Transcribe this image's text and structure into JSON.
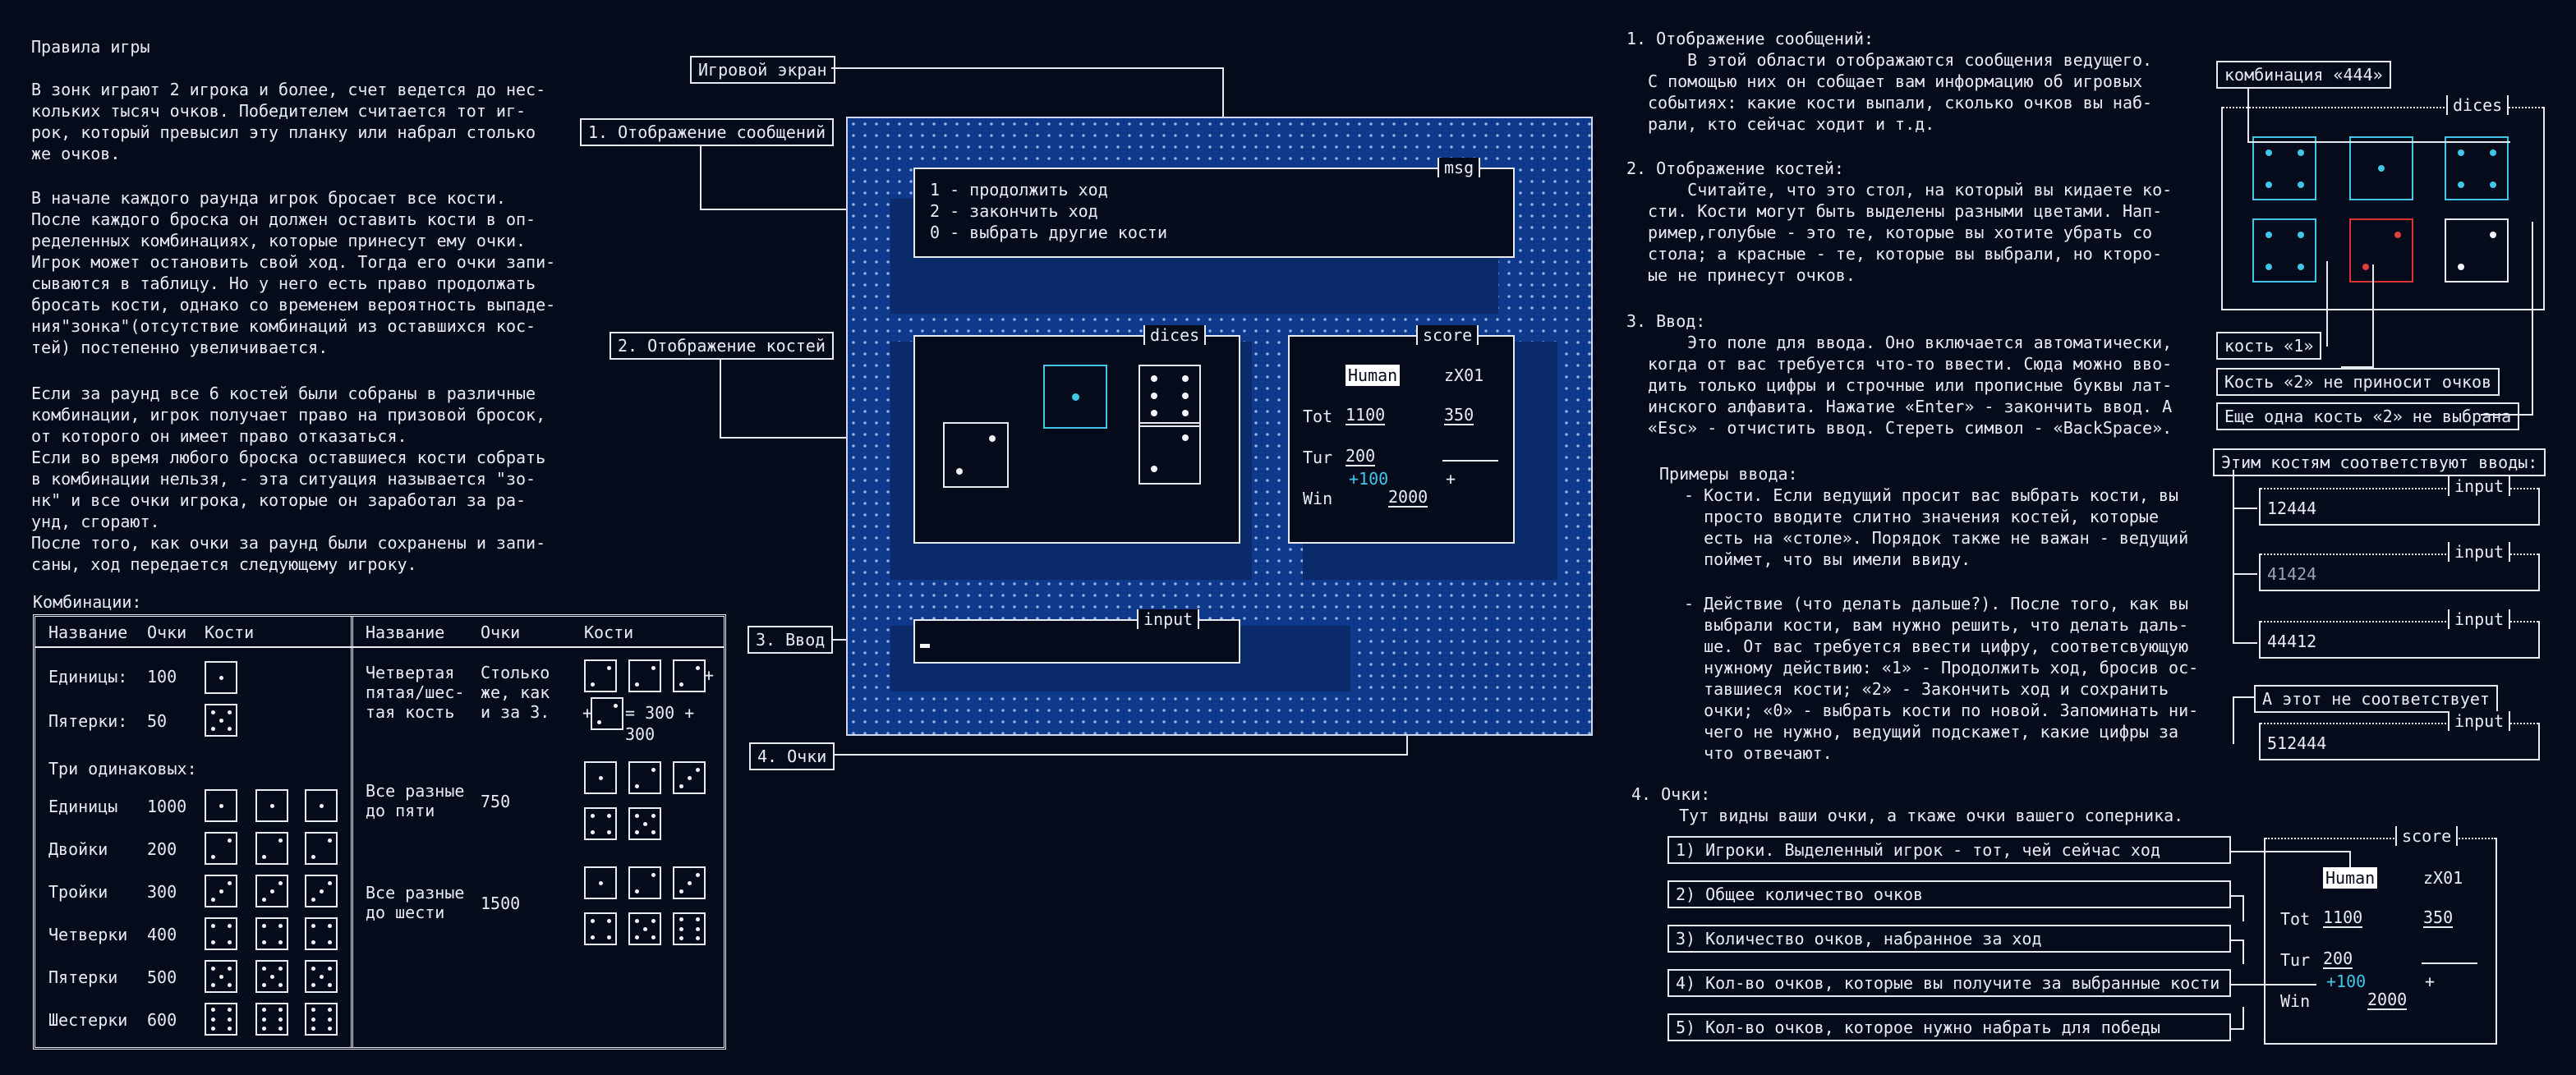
{
  "rules": {
    "title": "Правила игры",
    "p1": "В зонк играют 2 игрока и более, счет ведется до нес-\nкольких тысяч очков. Победителем считается тот иг-\nрок, который превысил эту планку или набрал столько\nже очков.",
    "p2": "В начале каждого раунда игрок бросает все кости.\nПосле каждого броска он должен оставить кости в оп-\nределенных комбинациях, которые принесут ему очки.\nИгрок может остановить свой ход. Тогда его очки запи-\nсываются в таблицу. Но у него есть право продолжать\nбросать кости, однако со временем вероятность выпаде-\nния\"зонка\"(отсутствие комбинаций из оставшихся кос-\nтей) постепенно увеличивается.",
    "p3": "Если за раунд все 6 костей были собраны в различные\nкомбинации, игрок получает право на призовой бросок,\nот которого он имеет право отказаться.\nЕсли во время любого броска оставшиеся кости собрать\nв комбинации нельзя, - эта ситуация называется \"зо-\nнк\" и все очки игрока, которые он заработал за ра-\nунд, сгорают.\nПосле того, как очки за раунд были сохранены и запи-\nсаны, ход передается следующему игроку.",
    "combos_label": "Комбинации:"
  },
  "table": {
    "headers": [
      "Название",
      "Очки",
      "Кости"
    ],
    "left_rows": [
      {
        "name": "Единицы:",
        "points": "100"
      },
      {
        "name": "Пятерки:",
        "points": "50"
      }
    ],
    "three_label": "Три одинаковых:",
    "three_rows": [
      {
        "name": "Единицы",
        "points": "1000"
      },
      {
        "name": "Двойки",
        "points": "200"
      },
      {
        "name": "Тройки",
        "points": "300"
      },
      {
        "name": "Четверки",
        "points": "400"
      },
      {
        "name": "Пятерки",
        "points": "500"
      },
      {
        "name": "Шестерки",
        "points": "600"
      }
    ],
    "right_rows": [
      {
        "name": "Четвертая\nпятая/шес-\nтая кость",
        "points": "Столько\nже, как\nи за 3.",
        "eq": "= 300 + 300",
        "plus": "+"
      },
      {
        "name": "Все разные\nдо пяти",
        "points": "750"
      },
      {
        "name": "Все разные\nдо шести",
        "points": "1500"
      }
    ]
  },
  "callouts": {
    "game_screen": "Игровой экран",
    "messages": "1. Отображение сообщений",
    "dice": "2. Отображение костей",
    "input": "3. Ввод",
    "score": "4. Очки"
  },
  "game": {
    "msg_title": "msg",
    "msg_lines": [
      "1 - продолжить ход",
      "2 - закончить ход",
      "0 - выбрать другие кости"
    ],
    "dices_title": "dices",
    "score_title": "score",
    "input_title": "input",
    "player1": "Human",
    "player2": "zX01",
    "tot_label": "Tot",
    "tot1": "1100",
    "tot2": "350",
    "tur_label": "Tur",
    "tur": "200",
    "bonus": "+100",
    "plus": "+",
    "win_label": "Win",
    "win": "2000"
  },
  "help": {
    "s1_title": "1. Отображение сообщений:",
    "s1_body": "    В этой области отображаются сообщения ведущего.\nС помощью них он собщает вам информацию об игровых\nсобытиях: какие кости выпали, сколько очков вы наб-\nрали, кто сейчас ходит и т.д.",
    "s2_title": "2. Отображение костей:",
    "s2_body": "    Считайте, что это стол, на который вы кидаете ко-\nсти. Кости могут быть выделены разными цветами. Нап-\nример,голубые - это те, которые вы хотите убрать со\nстола; а красные - те, которые вы выбрали, но кторо-\nые не принесут очков.",
    "s3_title": "3. Ввод:",
    "s3_body": "    Это поле для ввода. Оно включается автоматически,\nкогда от вас требуется что-то ввести. Сюда можно вво-\nдить только цифры и строчные или прописные буквы лат-\nинского алфавита. Нажатие «Enter» - закончить ввод. А\n«Esc» - отчистить ввод. Стереть символ - «BackSpace».",
    "s3_examples_title": "Примеры ввода:",
    "s3_ex1": "- Кости. Если ведущий просит вас выбрать кости, вы\n  просто вводите слитно значения костей, которые\n  есть на «столе». Порядок также не важан - ведущий\n  поймет, что вы имели ввиду.",
    "s3_ex2": "- Действие (что делать дальше?). После того, как вы\n  выбрали кости, вам нужно решить, что делать даль-\n  ше. От вас требуется ввести цифру, соответсвующую\n  нужному действию: «1» - Продолжить ход, бросив ос-\n  тавшиеся кости; «2» - Закончить ход и сохранить\n  очки; «0» - выбрать кости по новой. Запоминать ни-\n  чего не нужно, ведущий подскажет, какие цифры за\n  что отвечают.",
    "s4_title": "4. Очки:",
    "s4_body": "   Тут видны ваши очки, а ткаже очки вашего соперника."
  },
  "dice_example": {
    "label_444": "комбинация «444»",
    "title": "dices",
    "label_one": "кость «1»",
    "label_two": "Кость «2» не приносит очков",
    "label_two_more": "Еще одна кость «2» не выбрана"
  },
  "input_examples": {
    "caption": "Этим костям соответствуют вводы:",
    "title": "input",
    "values": [
      "12444",
      "41424",
      "44412"
    ],
    "bad_caption": "А этот не соответствует",
    "bad_value": "512444"
  },
  "score_legend": [
    "1) Игроки. Выделенный игрок - тот, чей сейчас ход",
    "2) Общее количество очков",
    "3) Количество очков, набранное за ход",
    "4) Кол-во очков, которые вы получите за выбранные кости",
    "5) Кол-во очков, которое нужно набрать для победы"
  ]
}
